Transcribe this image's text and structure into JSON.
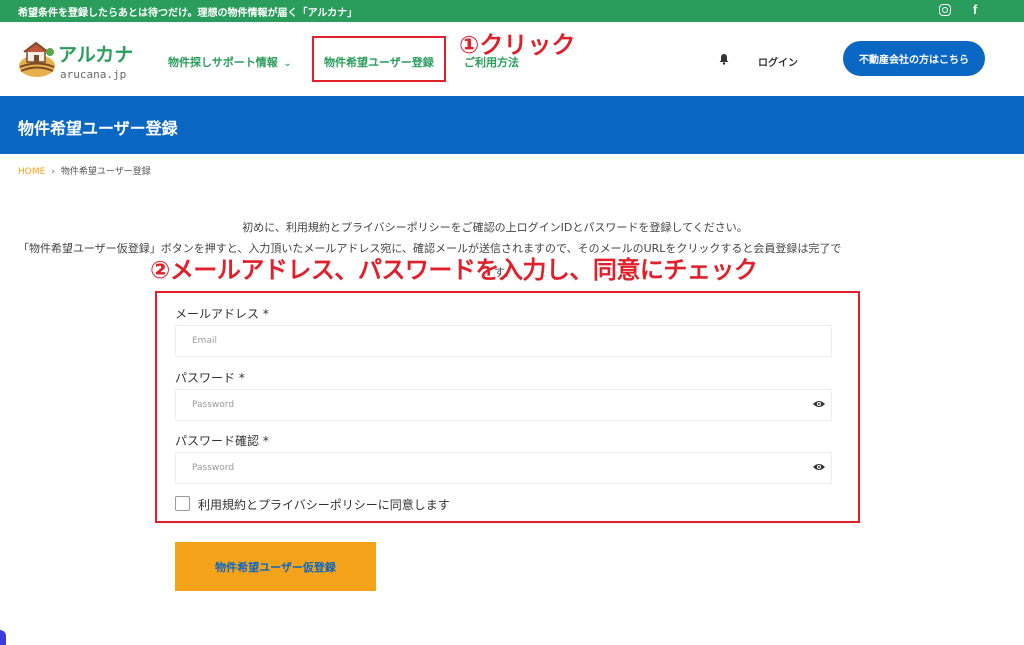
{
  "topbar": {
    "tagline": "希望条件を登録したらあとは待つだけ。理想の物件情報が届く「アルカナ」",
    "icons": [
      "instagram-icon",
      "facebook-icon"
    ],
    "facebook_glyph": "f"
  },
  "header": {
    "logo_text": "アルカナ",
    "logo_sub": "arucana.jp",
    "nav": [
      {
        "label": "物件探しサポート情報",
        "chevron": "⌄"
      },
      {
        "label": "物件希望ユーザー登録"
      },
      {
        "label": "ご利用方法"
      }
    ],
    "login": "ログイン",
    "company_button": "不動産会社の方はこちら"
  },
  "annotations": {
    "step1": "①クリック",
    "step2": "②メールアドレス、パスワードを入力し、同意にチェック"
  },
  "page": {
    "title": "物件希望ユーザー登録",
    "breadcrumb": {
      "home": "HOME",
      "sep": "›",
      "current": "物件希望ユーザー登録"
    }
  },
  "intro": {
    "line1": "初めに、利用規約とプライバシーポリシーをご確認の上ログインIDとパスワードを登録してください。",
    "line2": "「物件希望ユーザー仮登録」ボタンを押すと、入力頂いたメールアドレス宛に、確認メールが送信されますので、そのメールのURLをクリックすると会員登録は完了で",
    "line3": "す。"
  },
  "form": {
    "email_label": "メールアドレス *",
    "email_placeholder": "Email",
    "password_label": "パスワード *",
    "password_placeholder": "Password",
    "password_confirm_label": "パスワード確認 *",
    "password_confirm_placeholder": "Password",
    "agree_label": "利用規約とプライバシーポリシーに同意します",
    "agree_checked": false,
    "submit_label": "物件希望ユーザー仮登録"
  },
  "colors": {
    "green": "#2a9d5c",
    "blue": "#0b67c4",
    "orange": "#f5a31a",
    "annotation_red": "#e0202b"
  }
}
